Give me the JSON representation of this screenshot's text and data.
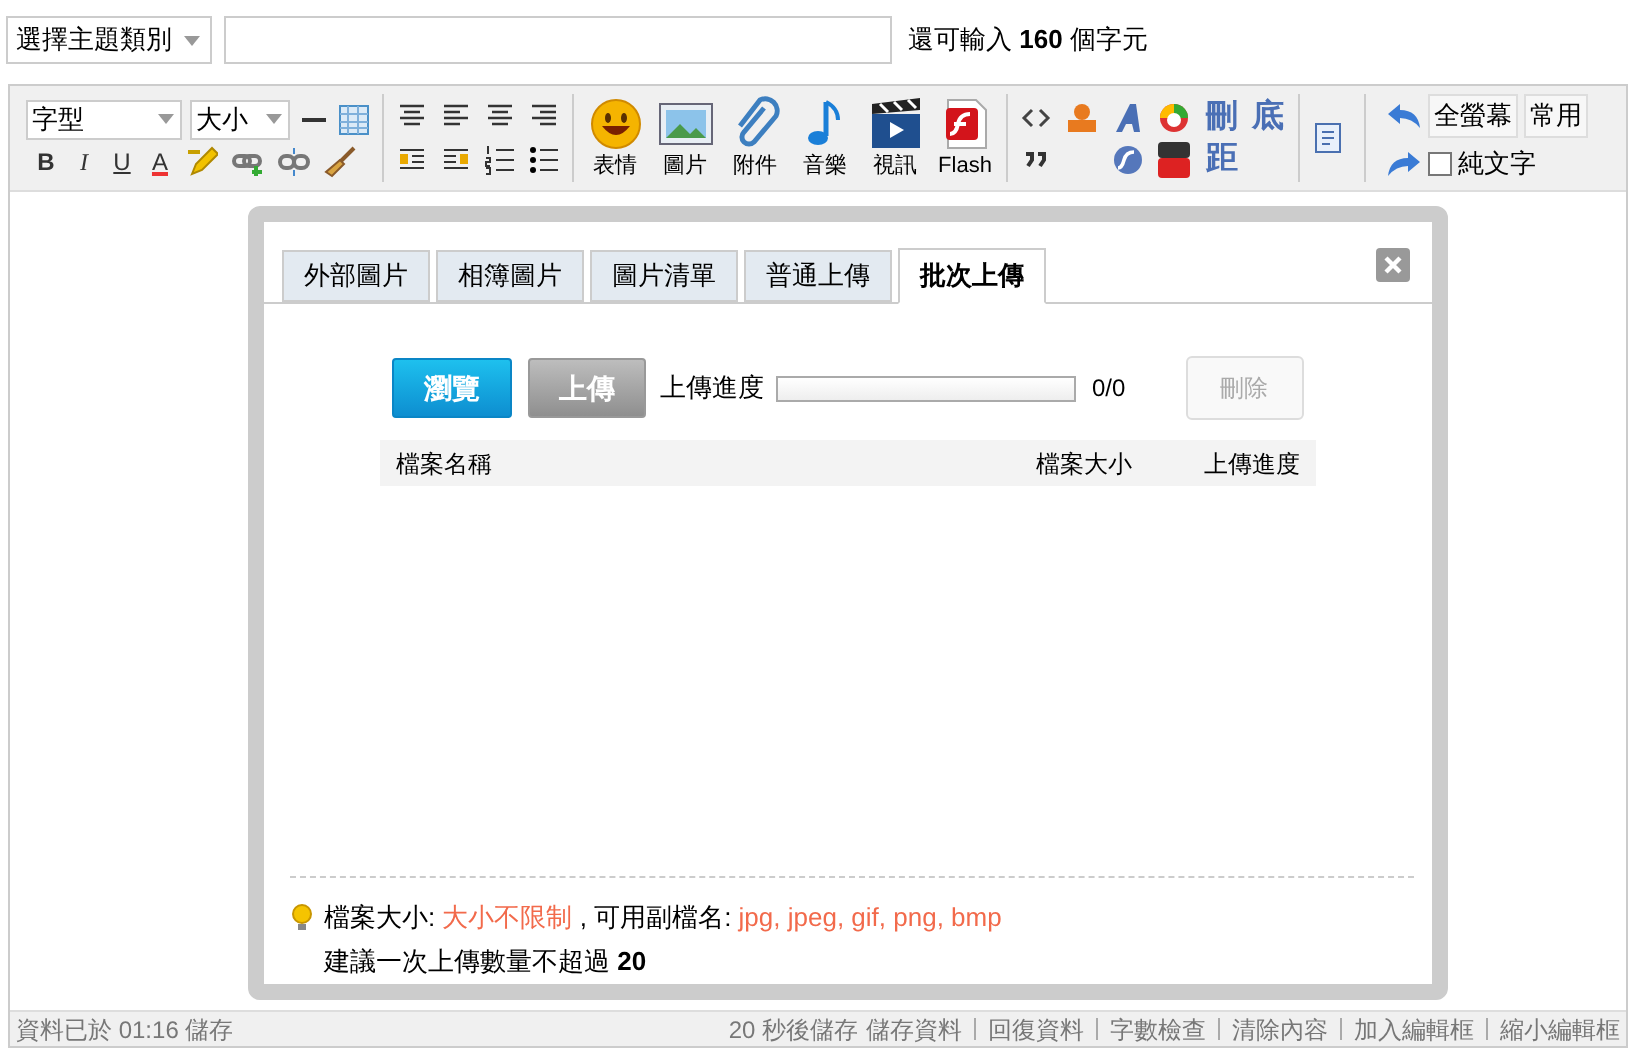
{
  "topic_select": {
    "value": "選擇主題類別"
  },
  "char_counter": "還可輸入 **160** 個字元",
  "toolbar": {
    "font_select": "字型",
    "size_select": "大小",
    "format_buttons": [
      "B",
      "I",
      "U",
      "A"
    ],
    "media_buttons": [
      {
        "label": "表情"
      },
      {
        "label": "圖片"
      },
      {
        "label": "附件"
      },
      {
        "label": "音樂"
      },
      {
        "label": "視訊"
      },
      {
        "label": "Flash"
      }
    ],
    "glyph_buttons": [
      "刪",
      "底",
      "距"
    ],
    "fullscreen_button": "全螢幕",
    "common_button": "常用",
    "plain_text": {
      "label": "純文字",
      "checked": false
    }
  },
  "dialog": {
    "tabs": [
      {
        "label": "外部圖片",
        "selected": false
      },
      {
        "label": "相簿圖片",
        "selected": false
      },
      {
        "label": "圖片清單",
        "selected": false
      },
      {
        "label": "普通上傳",
        "selected": false
      },
      {
        "label": "批次上傳",
        "selected": true
      }
    ],
    "browse_button": {
      "label": "瀏覽",
      "disabled": false
    },
    "upload_button": {
      "label": "上傳",
      "disabled": true
    },
    "progress": {
      "label": "上傳進度",
      "level": 0,
      "reading": "0/0"
    },
    "delete_button": {
      "label": "刪除",
      "disabled": true
    },
    "columns": [
      "檔案名稱",
      "檔案大小",
      "上傳進度"
    ],
    "note_parts": [
      {
        "text": "檔案大小: ",
        "highlight": false
      },
      {
        "text": "大小不限制",
        "highlight": true
      },
      {
        "text": " , 可用副檔名: ",
        "highlight": false
      },
      {
        "text": "jpg, jpeg, gif, png, bmp",
        "highlight": true
      }
    ],
    "note_line2": "建議一次上傳數量不超過 **20**"
  },
  "status_bar": {
    "save_info": "資料已於 01:16 儲存",
    "actions": [
      "20 秒後儲存",
      "儲存資料",
      "回復資料",
      "字數檢查",
      "清除內容",
      "加入編輯框",
      "縮小編輯框"
    ]
  }
}
